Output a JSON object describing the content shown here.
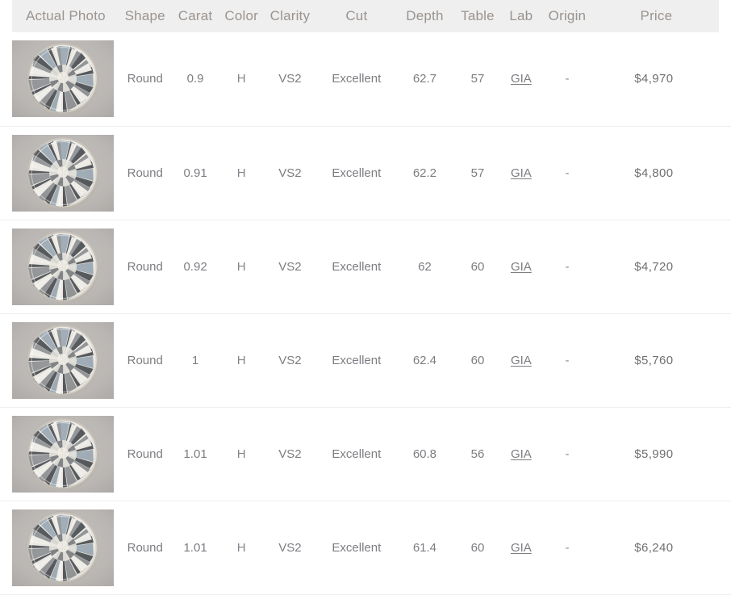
{
  "table": {
    "columns": [
      {
        "key": "photo",
        "label": "Actual Photo"
      },
      {
        "key": "shape",
        "label": "Shape"
      },
      {
        "key": "carat",
        "label": "Carat"
      },
      {
        "key": "color",
        "label": "Color"
      },
      {
        "key": "clarity",
        "label": "Clarity"
      },
      {
        "key": "cut",
        "label": "Cut"
      },
      {
        "key": "depth",
        "label": "Depth"
      },
      {
        "key": "table",
        "label": "Table"
      },
      {
        "key": "lab",
        "label": "Lab"
      },
      {
        "key": "origin",
        "label": "Origin"
      },
      {
        "key": "price",
        "label": "Price"
      }
    ],
    "rows": [
      {
        "photo_alt": "round-brilliant-diamond-photo",
        "shape": "Round",
        "carat": "0.9",
        "color": "H",
        "clarity": "VS2",
        "cut": "Excellent",
        "depth": "62.7",
        "table": "57",
        "lab": "GIA",
        "origin": "-",
        "price": "$4,970"
      },
      {
        "photo_alt": "round-brilliant-diamond-photo",
        "shape": "Round",
        "carat": "0.91",
        "color": "H",
        "clarity": "VS2",
        "cut": "Excellent",
        "depth": "62.2",
        "table": "57",
        "lab": "GIA",
        "origin": "-",
        "price": "$4,800"
      },
      {
        "photo_alt": "round-brilliant-diamond-photo",
        "shape": "Round",
        "carat": "0.92",
        "color": "H",
        "clarity": "VS2",
        "cut": "Excellent",
        "depth": "62",
        "table": "60",
        "lab": "GIA",
        "origin": "-",
        "price": "$4,720"
      },
      {
        "photo_alt": "round-brilliant-diamond-photo",
        "shape": "Round",
        "carat": "1",
        "color": "H",
        "clarity": "VS2",
        "cut": "Excellent",
        "depth": "62.4",
        "table": "60",
        "lab": "GIA",
        "origin": "-",
        "price": "$5,760"
      },
      {
        "photo_alt": "round-brilliant-diamond-photo",
        "shape": "Round",
        "carat": "1.01",
        "color": "H",
        "clarity": "VS2",
        "cut": "Excellent",
        "depth": "60.8",
        "table": "56",
        "lab": "GIA",
        "origin": "-",
        "price": "$5,990"
      },
      {
        "photo_alt": "round-brilliant-diamond-photo",
        "shape": "Round",
        "carat": "1.01",
        "color": "H",
        "clarity": "VS2",
        "cut": "Excellent",
        "depth": "61.4",
        "table": "60",
        "lab": "GIA",
        "origin": "-",
        "price": "$6,240"
      }
    ]
  },
  "colors": {
    "header_background": "#efefef",
    "header_text": "#9a9490",
    "body_text": "#7d7d82",
    "price_text": "#6f7072",
    "row_divider": "#eeeeee",
    "photo_background": "#bbb7b5",
    "page_background": "#ffffff"
  }
}
